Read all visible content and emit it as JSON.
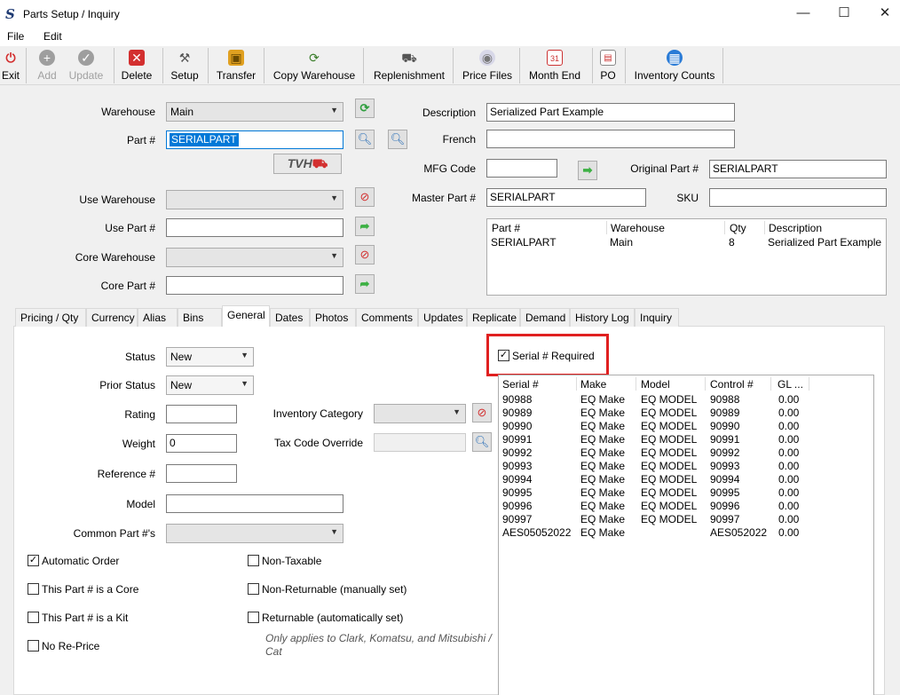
{
  "window": {
    "title": "Parts Setup / Inquiry",
    "icon": "S",
    "minimize": "—",
    "maximize": "☐",
    "close": "✕"
  },
  "menu": [
    "File",
    "Edit"
  ],
  "toolbar": [
    {
      "label": "Exit",
      "icon": "exit-icon",
      "enabled": true
    },
    {
      "label": "Add",
      "icon": "add-icon",
      "enabled": false
    },
    {
      "label": "Update",
      "icon": "update-icon",
      "enabled": false
    },
    {
      "label": "Delete",
      "icon": "delete-icon",
      "enabled": true
    },
    {
      "label": "Setup",
      "icon": "setup-icon",
      "enabled": true
    },
    {
      "label": "Transfer",
      "icon": "transfer-icon",
      "enabled": true
    },
    {
      "label": "Copy Warehouse",
      "icon": "copy-warehouse-icon",
      "enabled": true
    },
    {
      "label": "Replenishment",
      "icon": "truck-icon",
      "enabled": true
    },
    {
      "label": "Price Files",
      "icon": "disc-icon",
      "enabled": true
    },
    {
      "label": "Month End",
      "icon": "calendar-icon",
      "enabled": true
    },
    {
      "label": "PO",
      "icon": "po-icon",
      "enabled": true
    },
    {
      "label": "Inventory Counts",
      "icon": "clipboard-icon",
      "enabled": true
    }
  ],
  "form": {
    "warehouse_label": "Warehouse",
    "warehouse_value": "Main",
    "part_label": "Part #",
    "part_value": "SERIALPART",
    "tvh_logo": "TVH",
    "use_warehouse_label": "Use Warehouse",
    "use_warehouse_value": "",
    "use_part_label": "Use Part #",
    "use_part_value": "",
    "core_warehouse_label": "Core Warehouse",
    "core_warehouse_value": "",
    "core_part_label": "Core Part #",
    "core_part_value": "",
    "description_label": "Description",
    "description_value": "Serialized Part Example",
    "french_label": "French",
    "french_value": "",
    "mfg_code_label": "MFG Code",
    "mfg_code_value": "",
    "original_part_label": "Original Part #",
    "original_part_value": "SERIALPART",
    "master_part_label": "Master Part #",
    "master_part_value": "SERIALPART",
    "sku_label": "SKU",
    "sku_value": ""
  },
  "warehouse_grid": {
    "headers": [
      "Part #",
      "Warehouse",
      "Qty",
      "Description"
    ],
    "rows": [
      [
        "SERIALPART",
        "Main",
        "8",
        "Serialized Part Example"
      ]
    ]
  },
  "tabs": [
    "Pricing / Qty",
    "Currency",
    "Alias",
    "Bins",
    "General",
    "Dates",
    "Photos",
    "Comments",
    "Updates",
    "Replicate",
    "Demand",
    "History Log",
    "Inquiry"
  ],
  "active_tab": "General",
  "general": {
    "status_label": "Status",
    "status_value": "New",
    "prior_status_label": "Prior Status",
    "prior_status_value": "New",
    "rating_label": "Rating",
    "rating_value": "",
    "weight_label": "Weight",
    "weight_value": "0",
    "reference_label": "Reference #",
    "reference_value": "",
    "model_label": "Model",
    "model_value": "",
    "common_part_label": "Common Part #'s",
    "common_part_value": "",
    "inventory_category_label": "Inventory Category",
    "inventory_category_value": "",
    "tax_code_label": "Tax Code Override",
    "tax_code_value": "",
    "checkboxes_left": [
      {
        "label": "Automatic Order",
        "checked": true
      },
      {
        "label": "This Part # is a Core",
        "checked": false
      },
      {
        "label": "This Part # is a Kit",
        "checked": false
      },
      {
        "label": "No Re-Price",
        "checked": false
      }
    ],
    "checkboxes_right": [
      {
        "label": "Non-Taxable",
        "checked": false
      },
      {
        "label": "Non-Returnable (manually set)",
        "checked": false
      },
      {
        "label": "Returnable (automatically set)",
        "checked": false
      }
    ],
    "returnable_note": "Only applies to Clark, Komatsu, and Mitsubishi / Cat",
    "serial_required_label": "Serial # Required",
    "serial_required_checked": true,
    "highlight_color": "#e02020"
  },
  "serial_grid": {
    "headers": [
      "Serial #",
      "Make",
      "Model",
      "Control #",
      "GL ..."
    ],
    "rows": [
      [
        "90988",
        "EQ Make",
        "EQ MODEL",
        "90988",
        "0.00"
      ],
      [
        "90989",
        "EQ Make",
        "EQ MODEL",
        "90989",
        "0.00"
      ],
      [
        "90990",
        "EQ Make",
        "EQ MODEL",
        "90990",
        "0.00"
      ],
      [
        "90991",
        "EQ Make",
        "EQ MODEL",
        "90991",
        "0.00"
      ],
      [
        "90992",
        "EQ Make",
        "EQ MODEL",
        "90992",
        "0.00"
      ],
      [
        "90993",
        "EQ Make",
        "EQ MODEL",
        "90993",
        "0.00"
      ],
      [
        "90994",
        "EQ Make",
        "EQ MODEL",
        "90994",
        "0.00"
      ],
      [
        "90995",
        "EQ Make",
        "EQ MODEL",
        "90995",
        "0.00"
      ],
      [
        "90996",
        "EQ Make",
        "EQ MODEL",
        "90996",
        "0.00"
      ],
      [
        "90997",
        "EQ Make",
        "EQ MODEL",
        "90997",
        "0.00"
      ],
      [
        "AES05052022",
        "EQ Make",
        "",
        "AES052022",
        "0.00"
      ]
    ]
  },
  "colors": {
    "selection": "#0078d7",
    "delete_red": "#d32f2f",
    "green_arrow": "#3cb043",
    "refresh_green": "#2e9e3e"
  }
}
